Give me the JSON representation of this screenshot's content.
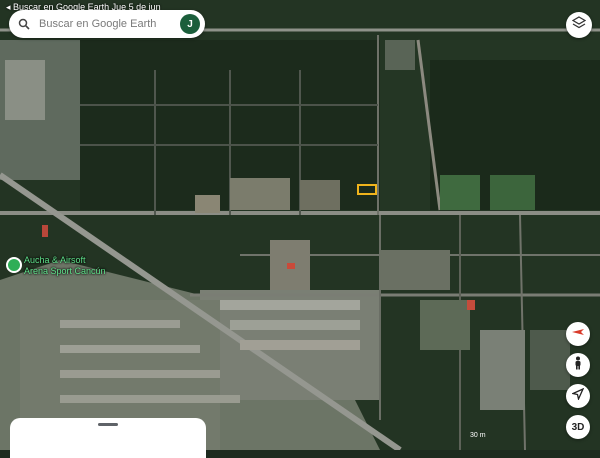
{
  "status": {
    "left": "Buscar en Google Earth",
    "date": "Jue 5 de jun",
    "right": ""
  },
  "search": {
    "placeholder": "Buscar en Google Earth",
    "avatar_letter": "J"
  },
  "poi": {
    "line1": "Aucha & Airsoft",
    "line2": "Arena Sport Cancún"
  },
  "controls": {
    "three_d_label": "3D"
  },
  "scale": {
    "label": "30 m"
  },
  "colors": {
    "accent": "#1b5e3b",
    "poi": "#2fae57",
    "highlight": "#f0b41c"
  }
}
